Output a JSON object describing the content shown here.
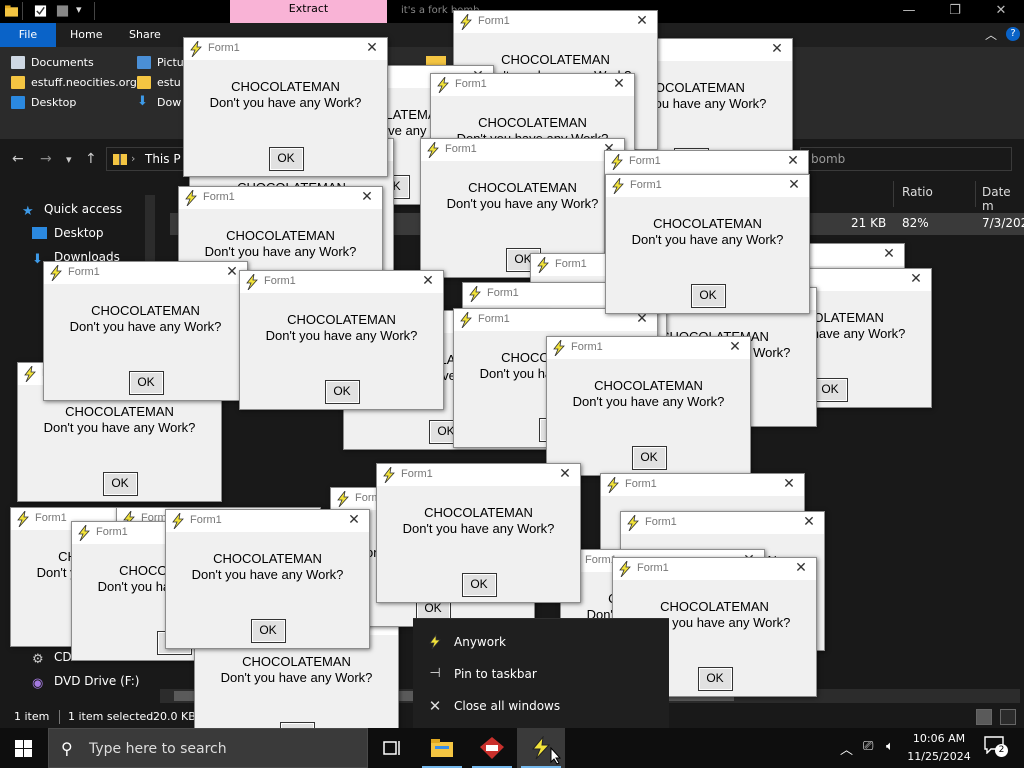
{
  "explorer": {
    "context_tab": "Extract",
    "window_title": "it's a fork bomb",
    "menu": {
      "file": "File",
      "home": "Home",
      "share": "Share"
    },
    "ribbon_items": [
      "Documents",
      "Pictu",
      "estuff.neocities.org",
      "estu",
      "Desktop",
      "Dow"
    ],
    "address": "This P",
    "search_placeholder": "bomb",
    "nav_pane": [
      "Quick access",
      "Desktop",
      "Downloads",
      "CD",
      "DVD Drive (F:)"
    ],
    "columns": [
      "Ratio",
      "Date m"
    ],
    "file_row": {
      "size": "21 KB",
      "ratio": "82%",
      "date": "7/3/202"
    },
    "status": {
      "count": "1 item",
      "selected": "1 item selected",
      "size": "20.0 KB"
    },
    "icons": {
      "back": "arrow-left-icon",
      "forward": "arrow-right-icon",
      "recent": "chevron-down-icon",
      "up": "arrow-up-icon"
    }
  },
  "popups": {
    "title": "Form1",
    "line1": "CHOCOLATEMAN",
    "line2": "Don't you have any Work?",
    "ok": "OK",
    "close_glyph": "✕"
  },
  "background_fragments": [
    "Don't you have any Work?",
    "OLA",
    "ave",
    "Dor",
    "CHOC",
    "Don't yo",
    "EMAN",
    "ork?",
    "EMA",
    "any Wo",
    "OLATEMAN",
    "ave any Work?",
    "ATEMAN",
    "e any Work?",
    "OK",
    "Ch",
    "Don't",
    "CHOCO",
    "Don't you ha"
  ],
  "jumplist": {
    "items": [
      {
        "label": "Anywork",
        "icon": "lightning-icon"
      },
      {
        "label": "Pin to taskbar",
        "icon": "pin-icon"
      },
      {
        "label": "Close all windows",
        "icon": "close-icon"
      }
    ]
  },
  "taskbar": {
    "search_placeholder": "Type here to search",
    "time": "10:06 AM",
    "date": "11/25/2024",
    "notifications": "2",
    "apps": [
      "task-view-icon",
      "file-explorer-icon",
      "winrar-icon",
      "anywork-icon"
    ]
  },
  "colors": {
    "accent": "#0a63c8",
    "context_tab": "#f9b3d6",
    "dark_bg": "#191919",
    "popup_bg": "#f0f0f0"
  }
}
